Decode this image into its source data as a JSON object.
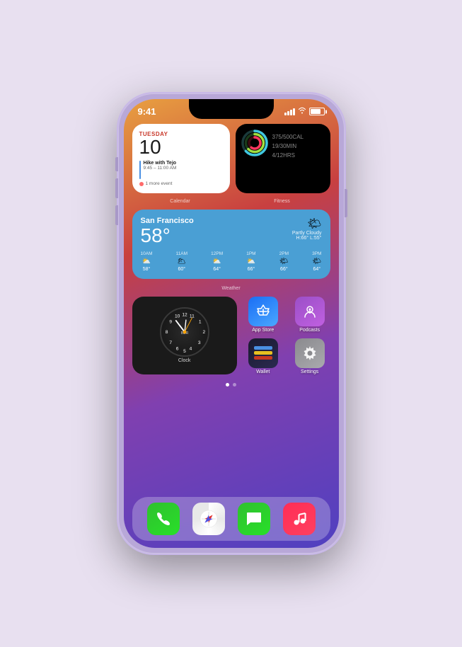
{
  "phone": {
    "status": {
      "time": "9:41",
      "signal": "●●●●",
      "wifi": "wifi",
      "battery": "battery"
    },
    "widgets": {
      "calendar": {
        "label": "Calendar",
        "day": "TUESDAY",
        "date": "10",
        "event_title": "Hike with Tejo",
        "event_time": "9:45 – 11:00 AM",
        "more_events": "1 more event"
      },
      "fitness": {
        "label": "Fitness",
        "move": "375/500",
        "move_unit": "CAL",
        "exercise": "19/30",
        "exercise_unit": "MIN",
        "stand": "4/12",
        "stand_unit": "HRS"
      },
      "weather": {
        "label": "Weather",
        "city": "San Francisco",
        "temp": "58°",
        "condition": "Partly Cloudy",
        "high": "H:66°",
        "low": "L:55°",
        "hourly": [
          {
            "time": "10AM",
            "icon": "⛅",
            "temp": "58°"
          },
          {
            "time": "11AM",
            "icon": "🌥",
            "temp": "60°"
          },
          {
            "time": "12PM",
            "icon": "⛅",
            "temp": "64°"
          },
          {
            "time": "1PM",
            "icon": "⛅",
            "temp": "66°"
          },
          {
            "time": "2PM",
            "icon": "🌤",
            "temp": "66°"
          },
          {
            "time": "3PM",
            "icon": "🌤",
            "temp": "64°"
          }
        ]
      },
      "clock": {
        "label": "Clock",
        "city_code": "BER"
      }
    },
    "apps": {
      "appstore": {
        "name": "App Store"
      },
      "podcasts": {
        "name": "Podcasts"
      },
      "wallet": {
        "name": "Wallet"
      },
      "settings": {
        "name": "Settings"
      }
    },
    "dock": {
      "phone": {
        "name": "Phone"
      },
      "safari": {
        "name": "Safari"
      },
      "messages": {
        "name": "Messages"
      },
      "music": {
        "name": "Music"
      }
    },
    "page_dots": [
      "active",
      "inactive"
    ]
  }
}
